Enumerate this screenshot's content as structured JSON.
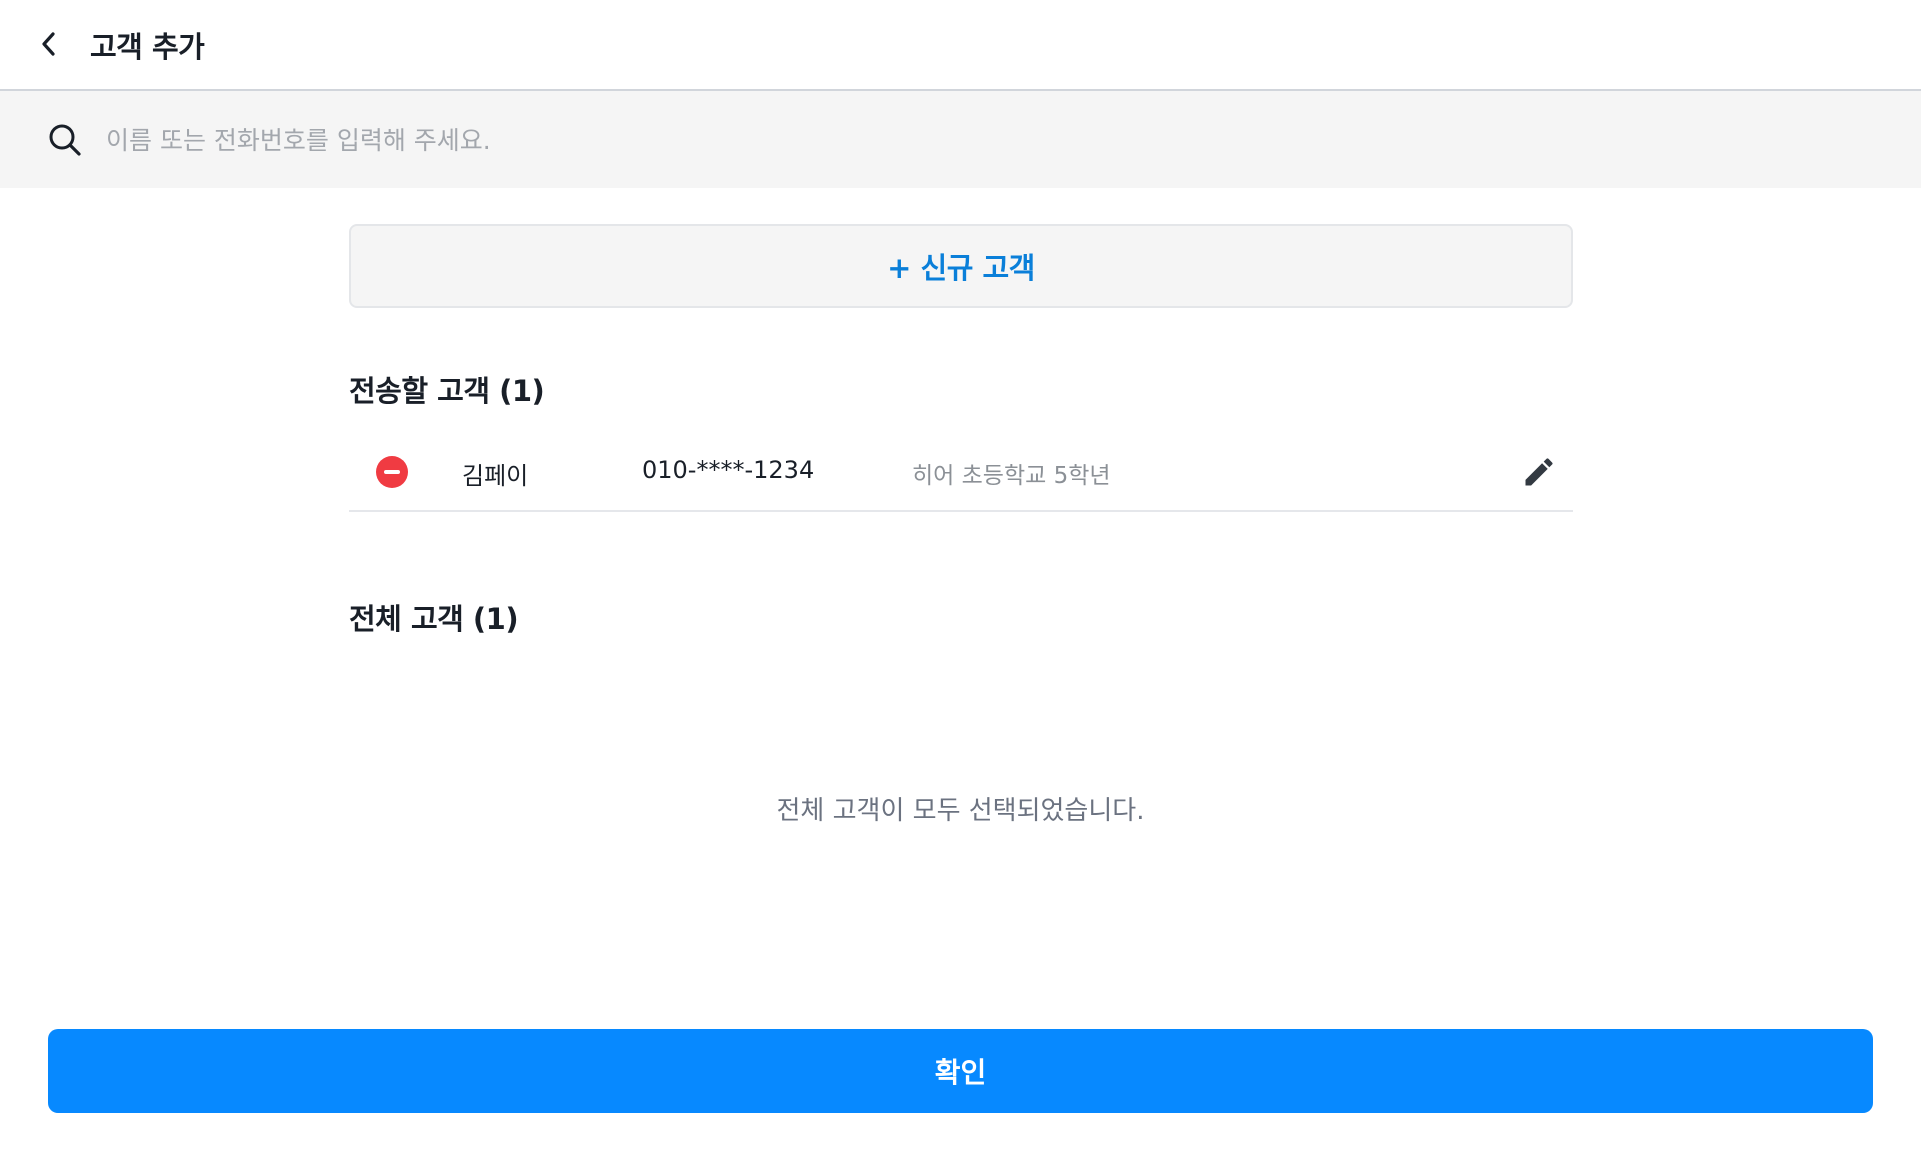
{
  "header": {
    "title": "고객 추가",
    "back_icon": "chevron-left-icon"
  },
  "search": {
    "placeholder": "이름 또는 전화번호를 입력해 주세요.",
    "value": "",
    "icon": "search-icon"
  },
  "new_customer": {
    "label": "+ 신규 고객",
    "color": "#0a7fd9"
  },
  "send_section": {
    "title": "전송할 고객 (1)",
    "customers": [
      {
        "name": "김페이",
        "phone": "010-****-1234",
        "note": "히어 초등학교 5학년",
        "remove_icon": "minus-circle-icon",
        "edit_icon": "pencil-icon"
      }
    ]
  },
  "all_section": {
    "title": "전체 고객 (1)",
    "empty_message": "전체 고객이 모두 선택되었습니다."
  },
  "confirm": {
    "label": "확인",
    "color": "#0789ff"
  },
  "colors": {
    "remove": "#f03b42",
    "accent": "#0789ff"
  }
}
